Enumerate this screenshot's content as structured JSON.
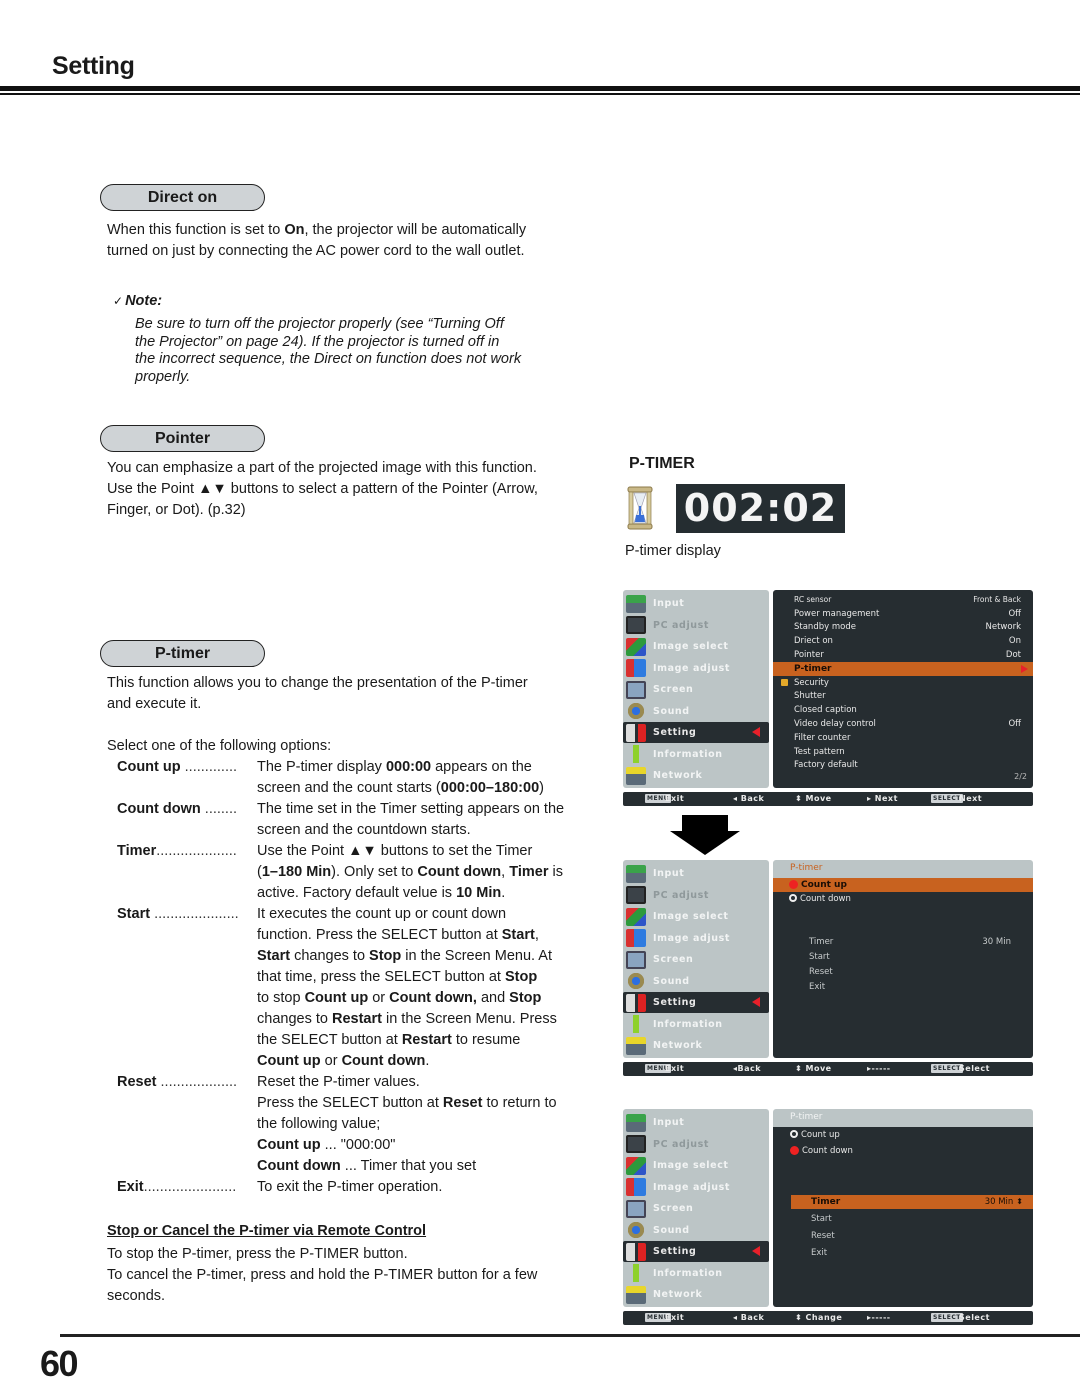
{
  "header": {
    "title": "Setting"
  },
  "direct_on": {
    "pill": "Direct on",
    "text_parts": [
      "When this function is set to ",
      "On",
      ", the projector will be automatically"
    ],
    "text_line2": "turned on just by connecting the AC power cord to the wall outlet.",
    "note_check": "✓",
    "note_label": "Note:",
    "note_lines": [
      "Be sure to turn off the projector properly (see “Turning Off",
      "the Projector” on page 24). If the projector is turned off in",
      "the incorrect sequence, the Direct on function does not work",
      "properly."
    ]
  },
  "pointer": {
    "pill": "Pointer",
    "lines": [
      "You can emphasize a part of the projected image with this function.",
      "Use the Point ▲▼ buttons to select a pattern of the Pointer (Arrow,",
      "Finger, or Dot). (p.32)"
    ]
  },
  "ptimer": {
    "pill": "P-timer",
    "intro_lines": [
      "This function allows you to change the presentation of the P-timer",
      "and execute it."
    ],
    "select_prompt": "Select one of the following options:",
    "options": [
      {
        "term": "Count up",
        "dots": " .............",
        "lines": [
          "The P-timer display <b>000:00</b> appears on the",
          "screen and the count starts (<b>000:00–180:00</b>)"
        ]
      },
      {
        "term": "Count down",
        "dots": " ........",
        "lines": [
          "The time set in the Timer setting appears on the",
          "screen and the countdown starts."
        ]
      },
      {
        "term": "Timer",
        "dots": "....................",
        "lines": [
          "Use the Point ▲▼ buttons to set the Timer",
          "(<b>1–180 Min</b>). Only set to <b>Count down</b>, <b>Timer</b> is",
          "active. Factory default velue is <b>10 Min</b>."
        ]
      },
      {
        "term": "Start",
        "dots": " .....................",
        "lines": [
          "It executes the count up or count down",
          "function. Press the SELECT button at <b>Start</b>,",
          "<b>Start</b> changes to <b>Stop</b> in the Screen Menu.  At",
          "that time, press the SELECT button at <b>Stop</b>",
          "to stop <b>Count up</b> or <b>Count down,</b>  and <b>Stop</b>",
          "changes to <b>Restart</b> in the Screen Menu. Press",
          "the SELECT button at <b>Restart</b> to resume",
          "<b>Count up</b> or <b>Count down</b>."
        ]
      },
      {
        "term": "Reset",
        "dots": " ...................",
        "lines": [
          "Reset the P-timer values.",
          "Press the SELECT button at <b>Reset</b> to return to",
          "the following value;",
          "<b>Count up</b> ... \"000:00\"",
          "<b>Count down</b> ... Timer that you set"
        ]
      },
      {
        "term": "Exit",
        "dots": ".......................",
        "lines": [
          "To exit the P-timer operation."
        ]
      }
    ],
    "remote_heading": "Stop or Cancel the P-timer via Remote Control",
    "remote_lines": [
      "To stop the P-timer, press the P-TIMER button.",
      "To cancel the P-timer, press and hold the P-TIMER button for a few",
      "seconds."
    ]
  },
  "display_figure": {
    "heading": "P-TIMER",
    "timer_value": "002:02",
    "caption": "P-timer display"
  },
  "osd_left_menu": [
    {
      "label": "Input",
      "icon": "input-icon"
    },
    {
      "label": "PC adjust",
      "icon": "pc-adjust-icon"
    },
    {
      "label": "Image select",
      "icon": "image-select-icon"
    },
    {
      "label": "Image adjust",
      "icon": "image-adjust-icon"
    },
    {
      "label": "Screen",
      "icon": "screen-icon"
    },
    {
      "label": "Sound",
      "icon": "sound-icon"
    },
    {
      "label": "Setting",
      "icon": "setting-icon"
    },
    {
      "label": "Information",
      "icon": "information-icon"
    },
    {
      "label": "Network",
      "icon": "network-icon"
    }
  ],
  "osd1": {
    "rows": [
      {
        "k": "RC sensor",
        "v": "Front & Back"
      },
      {
        "k": "Power management",
        "v": "Off"
      },
      {
        "k": "Standby mode",
        "v": "Network"
      },
      {
        "k": "Driect on",
        "v": "On"
      },
      {
        "k": "Pointer",
        "v": "Dot"
      },
      {
        "k": "P-timer",
        "v": ""
      },
      {
        "k": "Security",
        "v": ""
      },
      {
        "k": "Shutter",
        "v": ""
      },
      {
        "k": "Closed caption",
        "v": ""
      },
      {
        "k": "Video delay control",
        "v": "Off"
      },
      {
        "k": "Filter counter",
        "v": ""
      },
      {
        "k": "Test pattern",
        "v": ""
      },
      {
        "k": "Factory default",
        "v": ""
      }
    ],
    "page_indicator": "2/2",
    "bar": {
      "menu_key": "MENU",
      "exit": "Exit",
      "back": "◂ Back",
      "move": "⬍ Move",
      "next": "▸ Next",
      "select_key": "SELECT",
      "select": "Next"
    }
  },
  "osd2": {
    "title": "P-timer",
    "count_up": "Count up",
    "count_down": "Count down",
    "timer_label": "Timer",
    "timer_value": "30 Min",
    "start": "Start",
    "reset": "Reset",
    "exit": "Exit",
    "bar": {
      "menu_key": "MENU",
      "exit": "Exit",
      "back": "◂Back",
      "move": "⬍ Move",
      "next": "▸-----",
      "select_key": "SELECT",
      "select": "Select"
    }
  },
  "osd3": {
    "title": "P-timer",
    "count_up": "Count up",
    "count_down": "Count down",
    "timer_label": "Timer",
    "timer_value": "30 Min",
    "start": "Start",
    "reset": "Reset",
    "exit": "Exit",
    "bar": {
      "menu_key": "MENU",
      "exit": "Exit",
      "back": "◂ Back",
      "move": "⬍ Change",
      "next": "▸-----",
      "select_key": "SELECT",
      "select": "Select"
    }
  },
  "colors": {
    "highlight": "#c8621f",
    "osd_dark": "#262d31",
    "osd_light": "#bcc5c6",
    "pill_bg": "#cfd3d6",
    "indicator_red": "#e8202a"
  },
  "footer": {
    "page_number": "60"
  }
}
